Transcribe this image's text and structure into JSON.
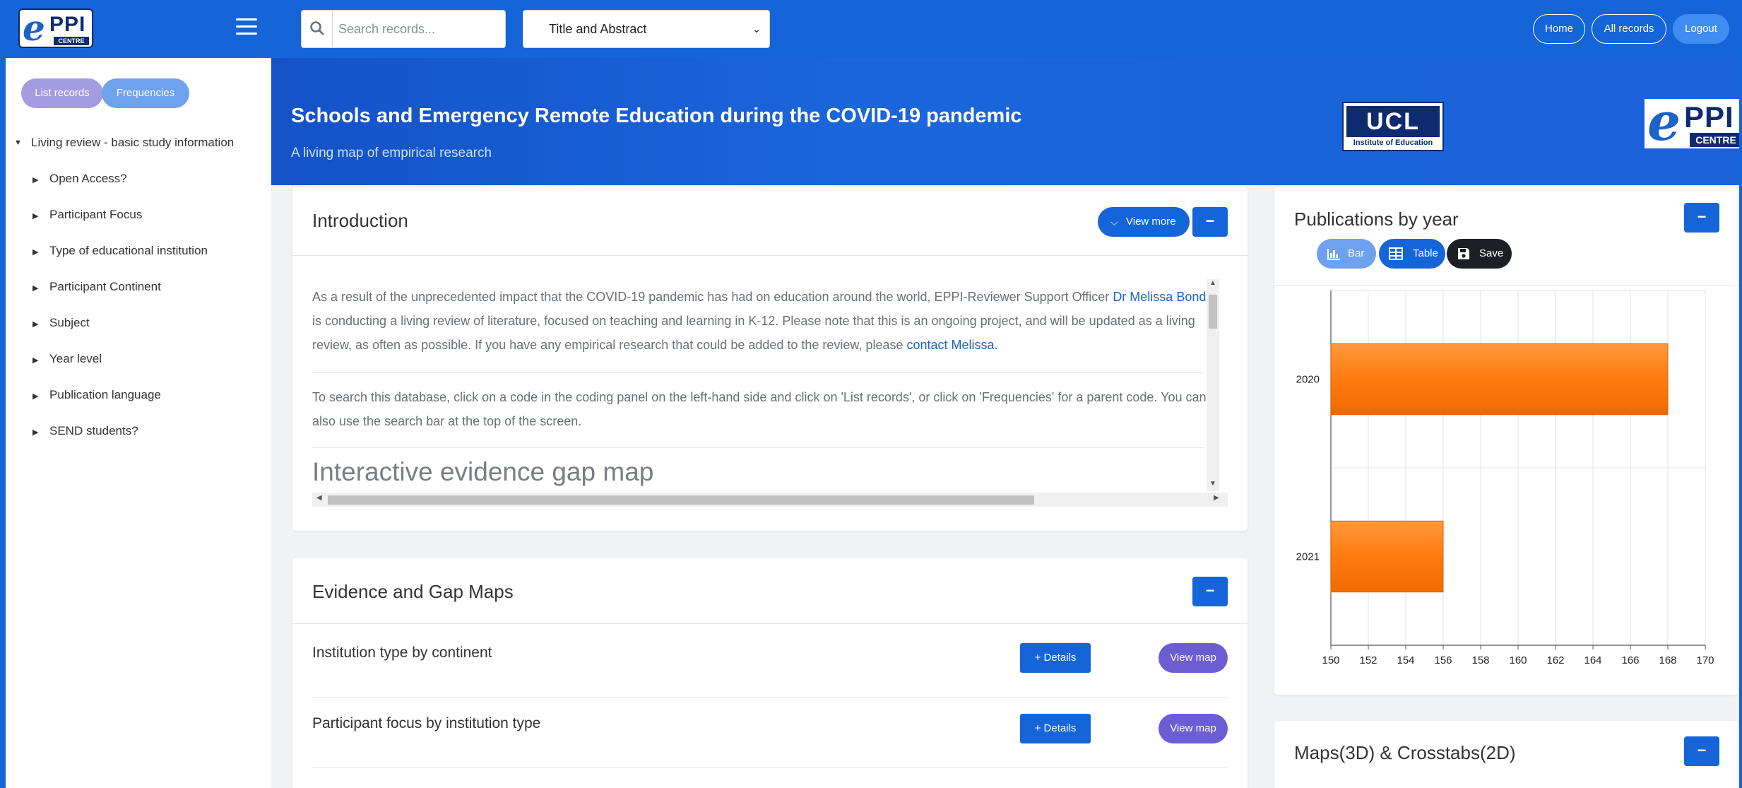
{
  "sidebar": {
    "buttons": {
      "list_records": "List records",
      "frequencies": "Frequencies"
    },
    "tree": {
      "root": "Living review - basic study information",
      "items": [
        "Open Access?",
        "Participant Focus",
        "Type of educational institution",
        "Participant Continent",
        "Subject",
        "Year level",
        "Publication language",
        "SEND students?"
      ]
    }
  },
  "logos": {
    "eppi": {
      "mark": "e",
      "ppi": "PPI",
      "centre": "CENTRE"
    },
    "ucl": {
      "mark": "UCL",
      "sub": "Institute of Education"
    }
  },
  "topnav": {
    "search_placeholder": "Search records...",
    "search_type": "Title and Abstract",
    "home": "Home",
    "all_records": "All records",
    "logout": "Logout"
  },
  "hero": {
    "title": "Schools and Emergency Remote Education during the COVID-19 pandemic",
    "subtitle": "A living map of empirical research"
  },
  "intro": {
    "title": "Introduction",
    "view_more": "View more",
    "collapse": "−",
    "p1_a": "As a result of the unprecedented impact that the COVID-19 pandemic has had on education around the world, EPPI-Reviewer Support Officer ",
    "p1_link": "Dr Melissa Bond",
    "p1_b": " is conducting a living review of literature, focused on teaching and learning in K-12. Please note that this is an ongoing project, and will be updated as a living review, as often as possible. If you have any empirical research that could be added to the review, please ",
    "p1_link2": "contact Melissa",
    "p1_c": ".",
    "p2": "To search this database, click on a code in the coding panel on the left-hand side and click on 'List records', or click on 'Frequencies' for a parent code. You can also use the search bar at the top of the screen.",
    "map_heading": "Interactive evidence gap map"
  },
  "evidence": {
    "title": "Evidence and Gap Maps",
    "collapse": "−",
    "rows": [
      {
        "label": "Institution type by continent",
        "details": "Details",
        "view_map": "View map"
      },
      {
        "label": "Participant focus by institution type",
        "details": "Details",
        "view_map": "View map"
      }
    ]
  },
  "publications": {
    "title": "Publications by year",
    "collapse": "−",
    "bar_label": "Bar",
    "table_label": "Table",
    "save_label": "Save"
  },
  "maps": {
    "title": "Maps(3D) & Crosstabs(2D)",
    "collapse": "−"
  },
  "colors": {
    "brand_blue": "#1565d8",
    "bar_orange": "#ff7a10",
    "purple": "#6c5dd3"
  },
  "chart_data": {
    "type": "bar",
    "orientation": "horizontal",
    "categories": [
      "2020",
      "2021"
    ],
    "values": [
      168,
      156
    ],
    "xlim": [
      150,
      170
    ],
    "xticks": [
      150,
      152,
      154,
      156,
      158,
      160,
      162,
      164,
      166,
      168,
      170
    ],
    "grid": true,
    "title": "",
    "xlabel": "",
    "ylabel": ""
  }
}
